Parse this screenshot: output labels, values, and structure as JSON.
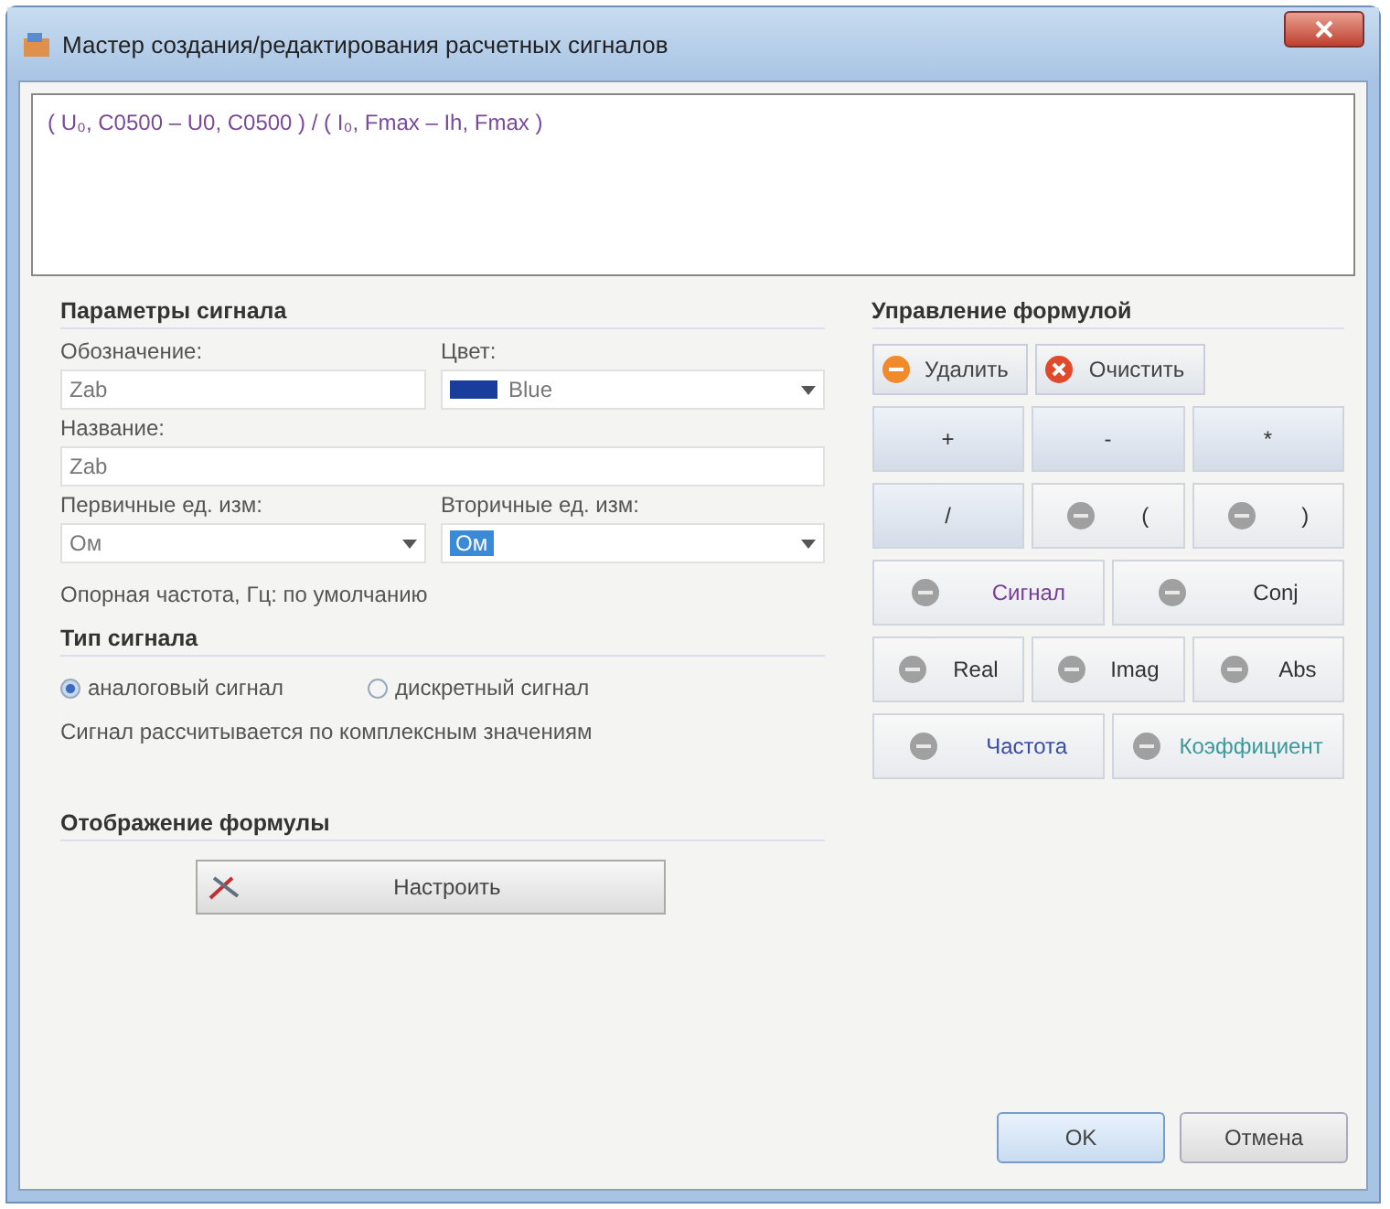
{
  "window": {
    "title": "Мастер создания/редактирования расчетных сигналов"
  },
  "formula": "( U₀, C0500 – U0, C0500 ) / ( I₀, Fmax – Ih, Fmax )",
  "params": {
    "title": "Параметры сигнала",
    "designation": {
      "label": "Обозначение:",
      "value": "Zab"
    },
    "color": {
      "label": "Цвет:",
      "value": "Blue",
      "color": "#1a3c9c"
    },
    "name": {
      "label": "Название:",
      "value": "Zab"
    },
    "primary_units": {
      "label": "Первичные ед. изм:",
      "value": "Ом"
    },
    "secondary_units": {
      "label": "Вторичные ед. изм:",
      "value": "Ом"
    },
    "ref_freq": "Опорная частота, Гц: по умолчанию"
  },
  "signal_type": {
    "title": "Тип сигнала",
    "options": [
      {
        "label": "аналоговый сигнал",
        "selected": true
      },
      {
        "label": "дискретный сигнал",
        "selected": false
      }
    ],
    "note": "Сигнал рассчитывается по комплексным значениям"
  },
  "formula_display": {
    "title": "Отображение формулы",
    "button": "Настроить"
  },
  "formula_control": {
    "title": "Управление формулой",
    "actions": [
      {
        "label": "Удалить",
        "kind": "delete"
      },
      {
        "label": "Очистить",
        "kind": "clear"
      }
    ],
    "rows": [
      [
        {
          "label": "+",
          "kind": "plain",
          "color": "#333333"
        },
        {
          "label": "-",
          "kind": "plain",
          "color": "#333333"
        },
        {
          "label": "*",
          "kind": "plain",
          "color": "#333333"
        }
      ],
      [
        {
          "label": "/",
          "kind": "plain",
          "color": "#333333"
        },
        {
          "label": "(",
          "kind": "icon",
          "color": "#333333"
        },
        {
          "label": ")",
          "kind": "icon",
          "color": "#333333"
        }
      ],
      [
        {
          "label": "Сигнал",
          "kind": "icon",
          "color": "#7a3c9a"
        },
        {
          "label": "Conj",
          "kind": "icon",
          "color": "#333333"
        }
      ],
      [
        {
          "label": "Real",
          "kind": "icon",
          "color": "#333333"
        },
        {
          "label": "Imag",
          "kind": "icon",
          "color": "#333333"
        },
        {
          "label": "Abs",
          "kind": "icon",
          "color": "#333333"
        }
      ],
      [
        {
          "label": "Частота",
          "kind": "icon",
          "color": "#3a4ea0"
        },
        {
          "label": "Коэффициент",
          "kind": "icon",
          "color": "#3a9a9a"
        }
      ]
    ]
  },
  "buttons": [
    "OK",
    "Отмена"
  ]
}
